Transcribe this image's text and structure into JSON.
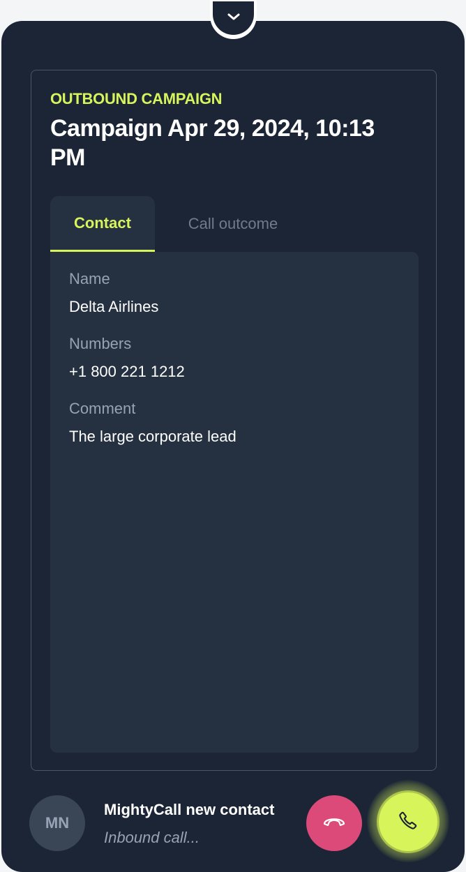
{
  "campaign": {
    "type_label": "OUTBOUND CAMPAIGN",
    "title": "Campaign Apr 29, 2024, 10:13 PM"
  },
  "tabs": [
    {
      "label": "Contact",
      "active": true
    },
    {
      "label": "Call outcome",
      "active": false
    }
  ],
  "contact": {
    "name_label": "Name",
    "name_value": "Delta Airlines",
    "numbers_label": "Numbers",
    "numbers_value": "+1 800 221 1212",
    "comment_label": "Comment",
    "comment_value": "The large corporate lead"
  },
  "call": {
    "avatar_initials": "MN",
    "caller_name": "MightyCall new contact",
    "status": "Inbound call..."
  },
  "icons": {
    "collapse": "chevron-down-icon",
    "decline": "hang-up-icon",
    "accept": "phone-icon"
  },
  "colors": {
    "background": "#1b2535",
    "accent": "#d8f45b",
    "decline": "#dc4a7a",
    "muted_text": "#97a3b4"
  }
}
